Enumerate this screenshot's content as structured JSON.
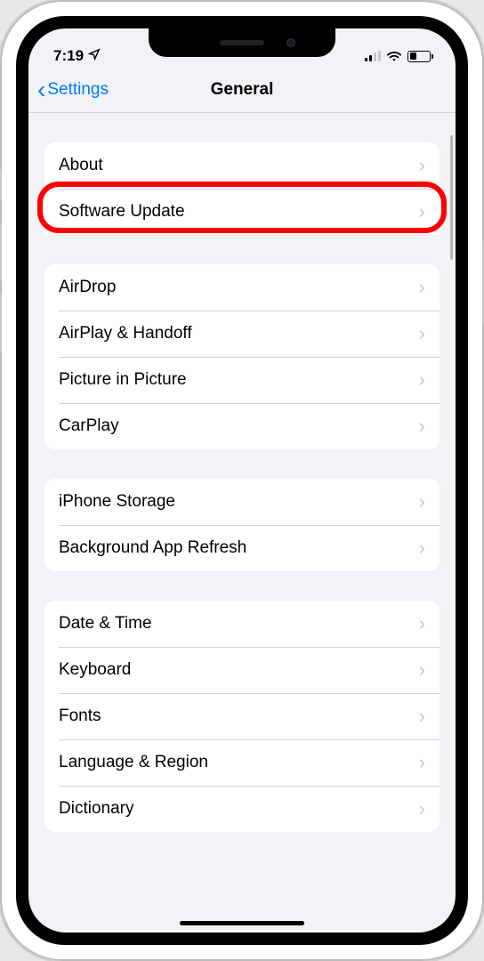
{
  "status": {
    "time": "7:19"
  },
  "nav": {
    "back_label": "Settings",
    "title": "General"
  },
  "groups": [
    {
      "id": "first",
      "items": [
        {
          "label": "About",
          "name": "about"
        },
        {
          "label": "Software Update",
          "name": "software-update",
          "highlighted": true
        }
      ]
    },
    {
      "id": "second",
      "items": [
        {
          "label": "AirDrop",
          "name": "airdrop"
        },
        {
          "label": "AirPlay & Handoff",
          "name": "airplay-handoff"
        },
        {
          "label": "Picture in Picture",
          "name": "picture-in-picture"
        },
        {
          "label": "CarPlay",
          "name": "carplay"
        }
      ]
    },
    {
      "id": "third",
      "items": [
        {
          "label": "iPhone Storage",
          "name": "iphone-storage"
        },
        {
          "label": "Background App Refresh",
          "name": "background-app-refresh"
        }
      ]
    },
    {
      "id": "fourth",
      "items": [
        {
          "label": "Date & Time",
          "name": "date-time"
        },
        {
          "label": "Keyboard",
          "name": "keyboard"
        },
        {
          "label": "Fonts",
          "name": "fonts"
        },
        {
          "label": "Language & Region",
          "name": "language-region"
        },
        {
          "label": "Dictionary",
          "name": "dictionary"
        }
      ]
    }
  ]
}
